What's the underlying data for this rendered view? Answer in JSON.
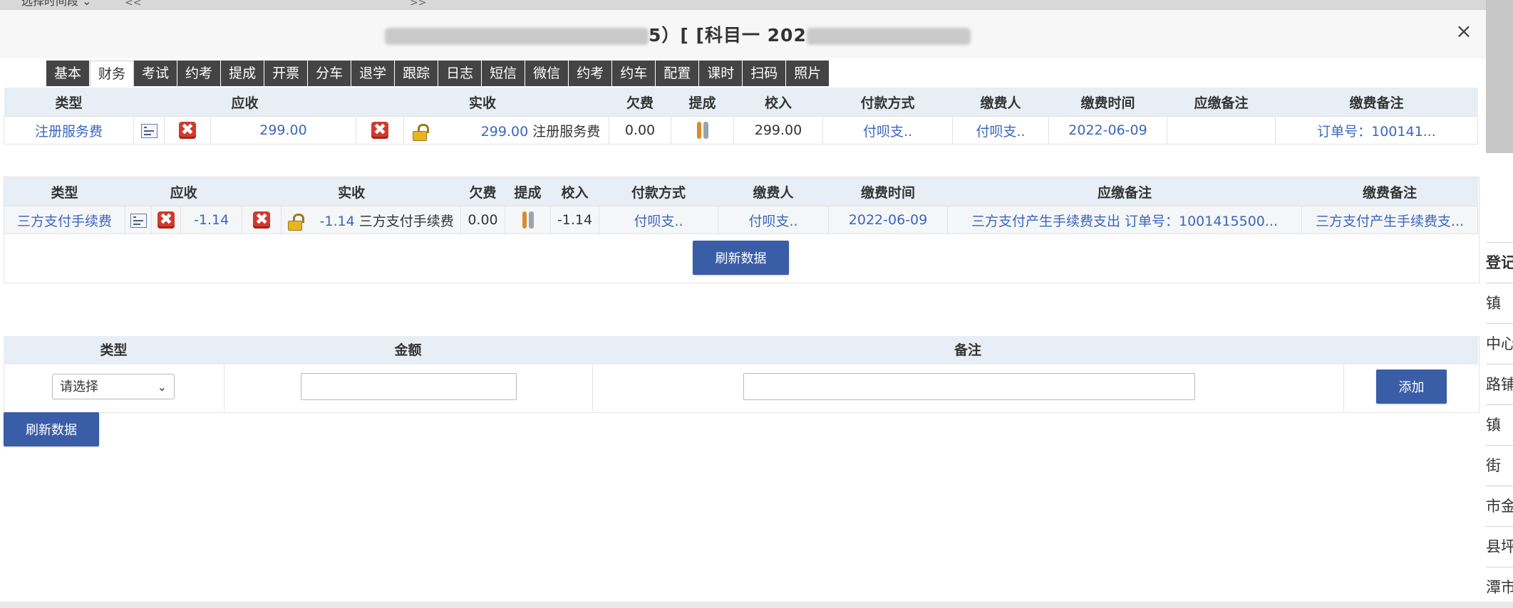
{
  "background": {
    "select_label": "选择时间段",
    "nav_left": "<<",
    "nav_right": ">>",
    "right_items": [
      "登记",
      "镇",
      "中心",
      "路铺",
      "镇",
      "街",
      "市金",
      "县坪",
      "潭市"
    ]
  },
  "modal": {
    "title_visible": "5）[ [科目一 202",
    "close_label": "×"
  },
  "tabs": [
    "基本",
    "财务",
    "考试",
    "约考",
    "提成",
    "开票",
    "分车",
    "退学",
    "跟踪",
    "日志",
    "短信",
    "微信",
    "约考",
    "约车",
    "配置",
    "课时",
    "扫码",
    "照片"
  ],
  "active_tab": "财务",
  "table1": {
    "headers": [
      "类型",
      "应收",
      "实收",
      "欠费",
      "提成",
      "校入",
      "付款方式",
      "缴费人",
      "缴费时间",
      "应缴备注",
      "缴费备注"
    ],
    "row": {
      "type": "注册服务费",
      "receivable": "299.00",
      "received_amount": "299.00",
      "received_label": "注册服务费",
      "arrears": "0.00",
      "income": "299.00",
      "pay_method": "付呗支..",
      "payer": "付呗支..",
      "pay_time": "2022-06-09",
      "due_note": "",
      "pay_note": "订单号：100141..."
    }
  },
  "table2": {
    "headers": [
      "类型",
      "应收",
      "实收",
      "欠费",
      "提成",
      "校入",
      "付款方式",
      "缴费人",
      "缴费时间",
      "应缴备注",
      "缴费备注"
    ],
    "row": {
      "type": "三方支付手续费",
      "receivable": "-1.14",
      "received_amount": "-1.14",
      "received_label": "三方支付手续费",
      "arrears": "0.00",
      "income": "-1.14",
      "pay_method": "付呗支..",
      "payer": "付呗支..",
      "pay_time": "2022-06-09",
      "due_note": "三方支付产生手续费支出 订单号：1001415500...",
      "pay_note": "三方支付产生手续费支..."
    },
    "refresh_label": "刷新数据"
  },
  "add_form": {
    "headers": [
      "类型",
      "金额",
      "备注"
    ],
    "select_placeholder": "请选择",
    "add_label": "添加"
  },
  "bottom_refresh_label": "刷新数据",
  "colors": {
    "tab_bg": "#444444",
    "header_bg": "#e8eef6",
    "link_blue": "#3a66c0",
    "button_blue": "#3a5da8"
  }
}
